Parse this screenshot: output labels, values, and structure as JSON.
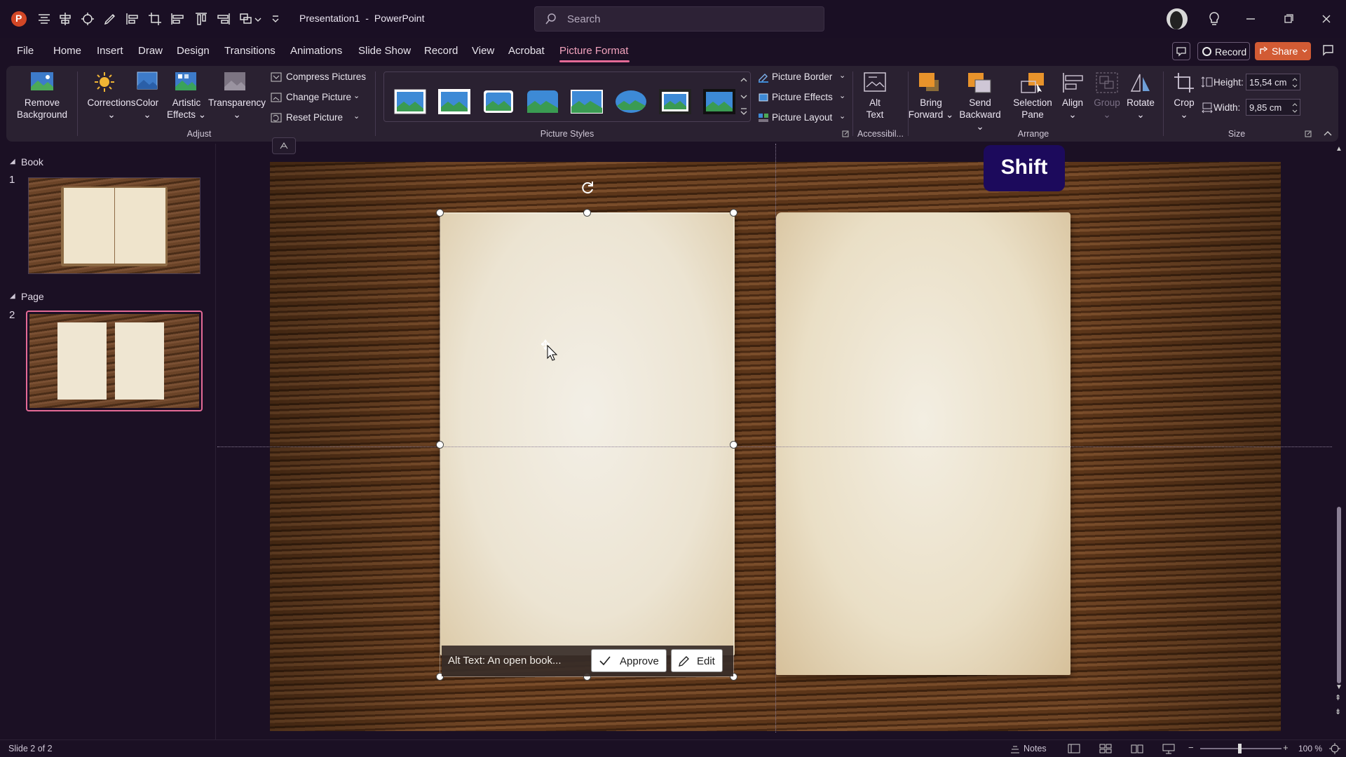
{
  "titlebar": {
    "document_name": "Presentation1",
    "separator": "-",
    "app_name": "PowerPoint",
    "search_placeholder": "Search"
  },
  "menu": {
    "tabs": [
      "File",
      "Home",
      "Insert",
      "Draw",
      "Design",
      "Transitions",
      "Animations",
      "Slide Show",
      "Record",
      "View",
      "Acrobat",
      "Picture Format"
    ],
    "active_tab": "Picture Format",
    "record_label": "Record",
    "share_label": "Share"
  },
  "ribbon": {
    "adjust": {
      "remove_background": [
        "Remove",
        "Background"
      ],
      "corrections": "Corrections",
      "color": "Color",
      "artistic_effects": [
        "Artistic",
        "Effects"
      ],
      "transparency": "Transparency",
      "compress_pictures": "Compress Pictures",
      "change_picture": "Change Picture",
      "reset_picture": "Reset Picture",
      "group_label": "Adjust"
    },
    "picture_styles": {
      "group_label": "Picture Styles",
      "picture_border": "Picture Border",
      "picture_effects": "Picture Effects",
      "picture_layout": "Picture Layout"
    },
    "accessibility": {
      "alt_text": [
        "Alt",
        "Text"
      ],
      "group_label": "Accessibil..."
    },
    "arrange": {
      "bring_forward": [
        "Bring",
        "Forward"
      ],
      "send_backward": [
        "Send",
        "Backward"
      ],
      "selection_pane": [
        "Selection",
        "Pane"
      ],
      "align": "Align",
      "group": "Group",
      "rotate": "Rotate",
      "group_label": "Arrange"
    },
    "size": {
      "crop": "Crop",
      "height_label": "Height:",
      "height_value": "15,54 cm",
      "width_label": "Width:",
      "width_value": "9,85 cm",
      "group_label": "Size"
    }
  },
  "slides_panel": {
    "sections": [
      {
        "title": "Book",
        "slide_number": "1"
      },
      {
        "title": "Page",
        "slide_number": "2"
      }
    ]
  },
  "canvas": {
    "alt_text": "Alt Text: An open book...",
    "approve_label": "Approve",
    "edit_label": "Edit",
    "shift_badge": "Shift"
  },
  "statusbar": {
    "slide_info": "Slide 2 of 2",
    "notes_label": "Notes",
    "zoom": "100 %"
  },
  "colors": {
    "accent": "#e46a96",
    "share": "#d25b34",
    "ribbon_bg": "#2a2131",
    "app_bg": "#1b1024",
    "shift_badge": "#1c0a5c"
  }
}
